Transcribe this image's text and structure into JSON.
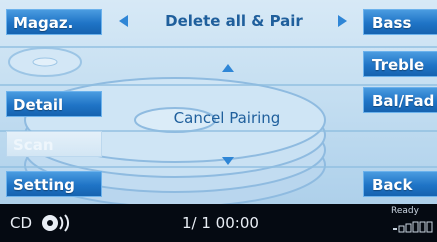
{
  "header": {
    "title": "Delete all & Pair"
  },
  "left_buttons": [
    {
      "label": "Magaz."
    },
    {
      "label": "Detail"
    },
    {
      "label": "Scan"
    },
    {
      "label": "Setting"
    }
  ],
  "right_buttons": [
    {
      "label": "Bass"
    },
    {
      "label": "Treble"
    },
    {
      "label": "Bal/Fad"
    },
    {
      "label": "Back"
    }
  ],
  "center": {
    "label": "Cancel Pairing"
  },
  "status_bar": {
    "source": "CD",
    "track_time": "1/ 1 00:00",
    "state": "Ready"
  },
  "colors": {
    "button": "#1f74c6",
    "accent_text": "#1f5f9c",
    "background": "#c4def1",
    "status_bar": "#050a12"
  },
  "icons": [
    "arrow-left-icon",
    "arrow-right-icon",
    "arrow-up-icon",
    "arrow-down-icon",
    "cd-disc-icon",
    "signal-strength-icon"
  ]
}
